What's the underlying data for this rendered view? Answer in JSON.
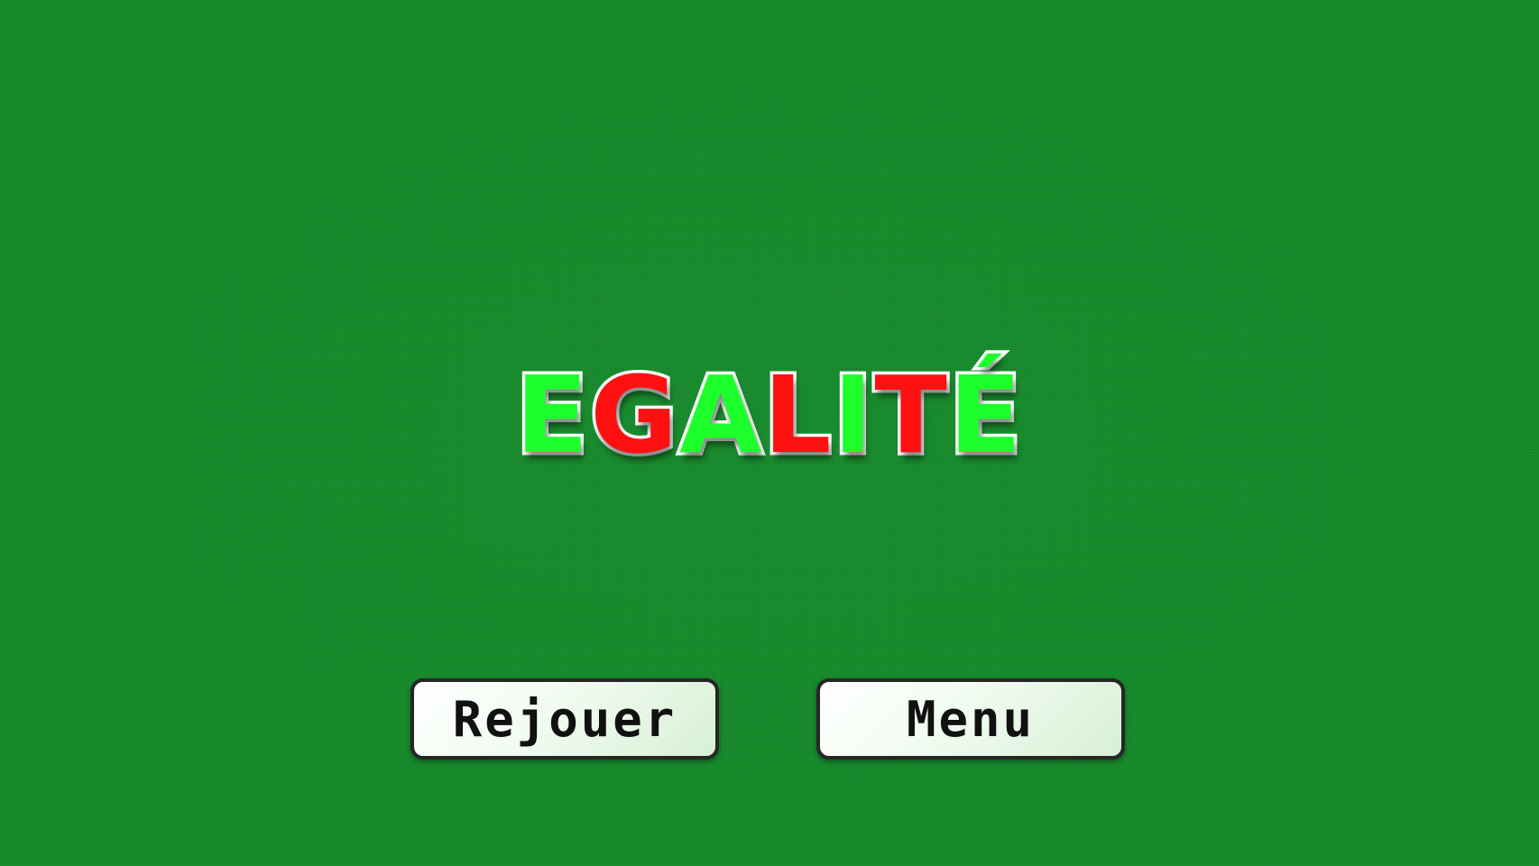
{
  "title": {
    "letters": [
      {
        "char": "E",
        "color": "#1dff2a"
      },
      {
        "char": "G",
        "color": "#ff1010"
      },
      {
        "char": "A",
        "color": "#1dff2a"
      },
      {
        "char": "L",
        "color": "#ff1010"
      },
      {
        "char": "I",
        "color": "#1dff2a"
      },
      {
        "char": "T",
        "color": "#ff1010"
      },
      {
        "char": "É",
        "color": "#1dff2a"
      }
    ]
  },
  "buttons": {
    "replay_label": "Rejouer",
    "menu_label": "Menu"
  },
  "colors": {
    "background": "#138a28",
    "title_green": "#1dff2a",
    "title_red": "#ff1010",
    "title_outline": "#ffffff",
    "button_border": "#262626",
    "button_text": "#111111"
  }
}
